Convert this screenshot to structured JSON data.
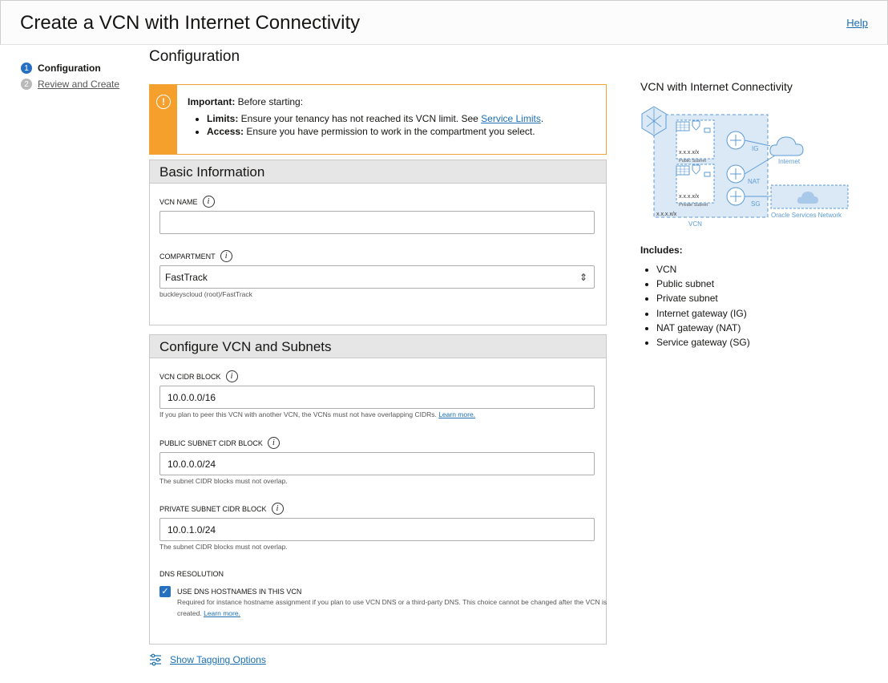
{
  "header": {
    "title": "Create a VCN with Internet Connectivity",
    "help": "Help"
  },
  "steps": [
    {
      "num": "1",
      "label": "Configuration"
    },
    {
      "num": "2",
      "label": "Review and Create"
    }
  ],
  "page_title": "Configuration",
  "alert": {
    "lead_bold": "Important:",
    "lead_text": " Before starting:",
    "limits_bold": "Limits:",
    "limits_text": " Ensure your tenancy has not reached its VCN limit. See ",
    "limits_link": "Service Limits",
    "limits_end": ".",
    "access_bold": "Access:",
    "access_text": " Ensure you have permission to work in the compartment you select."
  },
  "basic": {
    "heading": "Basic Information",
    "vcn_name_label": "VCN NAME",
    "vcn_name_value": "",
    "compartment_label": "COMPARTMENT",
    "compartment_value": "FastTrack",
    "compartment_path": "buckleyscloud (root)/FastTrack"
  },
  "vcn": {
    "heading": "Configure VCN and Subnets",
    "cidr_label": "VCN CIDR BLOCK",
    "cidr_value": "10.0.0.0/16",
    "cidr_hint": "If you plan to peer this VCN with another VCN, the VCNs must not have overlapping CIDRs.",
    "learn_more": "Learn more.",
    "public_label": "PUBLIC SUBNET CIDR BLOCK",
    "public_value": "10.0.0.0/24",
    "public_hint": "The subnet CIDR blocks must not overlap.",
    "private_label": "PRIVATE SUBNET CIDR BLOCK",
    "private_value": "10.0.1.0/24",
    "private_hint": "The subnet CIDR blocks must not overlap.",
    "dns_label": "DNS RESOLUTION",
    "dns_checkbox": "USE DNS HOSTNAMES IN THIS VCN",
    "dns_checked": true,
    "dns_hint": "Required for instance hostname assignment if you plan to use VCN DNS or a third-party DNS. This choice cannot be changed after the VCN is created.",
    "dns_learn_more": "Learn more."
  },
  "tagging": "Show Tagging Options",
  "diagram": {
    "title": "VCN with Internet Connectivity",
    "cidr_tag": "x.x.x.x/x",
    "public_subnet": "Public Subnet",
    "private_subnet": "Private Subnet",
    "vcn": "VCN",
    "ig": "IG",
    "nat": "NAT",
    "sg": "SG",
    "internet": "Internet",
    "osn": "Oracle Services Network"
  },
  "includes": {
    "title": "Includes:",
    "items": [
      "VCN",
      "Public subnet",
      "Private subnet",
      "Internet gateway (IG)",
      "NAT gateway (NAT)",
      "Service gateway (SG)"
    ]
  },
  "colors": {
    "accent": "#2670c2",
    "warning": "#f59f2d",
    "diagram_blue": "#5b9bd5"
  }
}
